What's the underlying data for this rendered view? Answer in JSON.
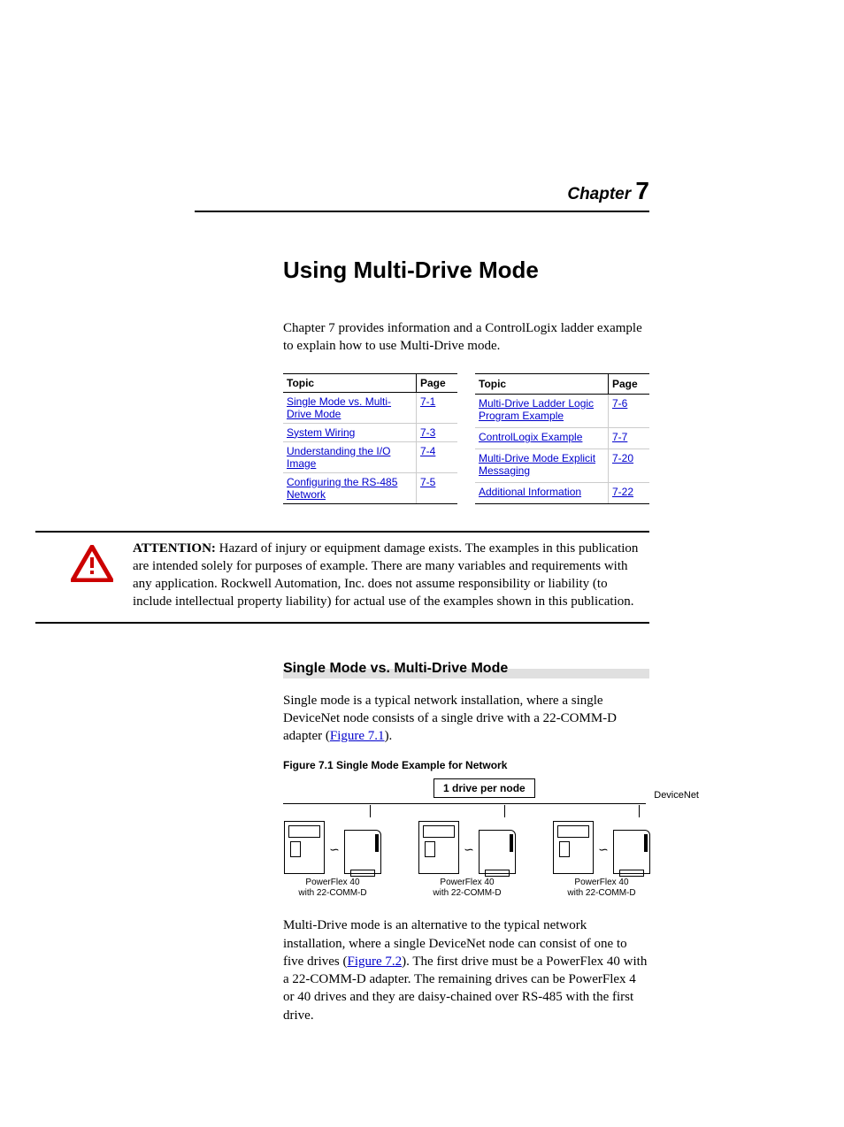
{
  "chapter": {
    "word": "Chapter",
    "num": "7"
  },
  "title": "Using Multi-Drive Mode",
  "intro": "Chapter 7 provides information and a ControlLogix ladder example to explain how to use Multi-Drive mode.",
  "toc_headers": {
    "topic": "Topic",
    "page": "Page"
  },
  "toc_left": [
    {
      "topic": "Single Mode vs. Multi-Drive Mode",
      "page": "7-1"
    },
    {
      "topic": "System Wiring",
      "page": "7-3"
    },
    {
      "topic": "Understanding the I/O Image",
      "page": "7-4"
    },
    {
      "topic": "Configuring the RS-485 Network",
      "page": "7-5"
    }
  ],
  "toc_right": [
    {
      "topic": "Multi-Drive Ladder Logic Program Example",
      "page": "7-6"
    },
    {
      "topic": "ControlLogix Example",
      "page": "7-7"
    },
    {
      "topic": "Multi-Drive Mode Explicit Messaging",
      "page": "7-20"
    },
    {
      "topic": "Additional Information",
      "page": "7-22"
    }
  ],
  "attention": {
    "label": "ATTENTION:",
    "text": "Hazard of injury or equipment damage exists. The examples in this publication are intended solely for purposes of example. There are many variables and requirements with any application. Rockwell Automation, Inc. does not assume responsibility or liability (to include intellectual property liability) for actual use of the examples shown in this publication."
  },
  "section1": {
    "heading": "Single Mode vs. Multi-Drive Mode",
    "p1_a": "Single mode is a typical network installation, where a single DeviceNet node consists of a single drive with a 22-COMM-D adapter (",
    "p1_link": "Figure 7.1",
    "p1_b": ")."
  },
  "figure1": {
    "caption": "Figure 7.1   Single Mode Example for Network",
    "box": "1 drive per node",
    "net": "DeviceNet",
    "drive_line1": "PowerFlex 40",
    "drive_line2": "with 22-COMM-D"
  },
  "p2_a": "Multi-Drive mode is an alternative to the typical network installation, where a single DeviceNet node can consist of one to five drives (",
  "p2_link": "Figure 7.2",
  "p2_b": "). The first drive must be a PowerFlex 40 with a 22-COMM-D adapter. The remaining drives can be PowerFlex 4 or 40 drives and they are daisy-chained over RS-485 with the first drive."
}
